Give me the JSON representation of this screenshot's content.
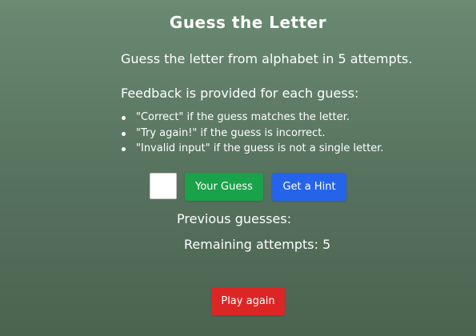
{
  "game": {
    "title": "Guess the Letter",
    "intro": "Guess the letter from alphabet in 5 attempts.",
    "feedback_title": "Feedback is provided for each guess:",
    "rules": [
      "\"Correct\" if the guess matches the letter.",
      "\"Try again!\" if the guess is incorrect.",
      "\"Invalid input\" if the guess is not a single letter."
    ]
  },
  "controls": {
    "guess_input_value": "",
    "guess_button_label": "Your Guess",
    "hint_button_label": "Get a Hint",
    "play_again_label": "Play again"
  },
  "status": {
    "previous_guesses_label": "Previous guesses:",
    "remaining_label": "Remaining attempts: 5"
  },
  "colors": {
    "guess_button": "#19a24a",
    "hint_button": "#2563eb",
    "play_again_button": "#dc2626"
  }
}
